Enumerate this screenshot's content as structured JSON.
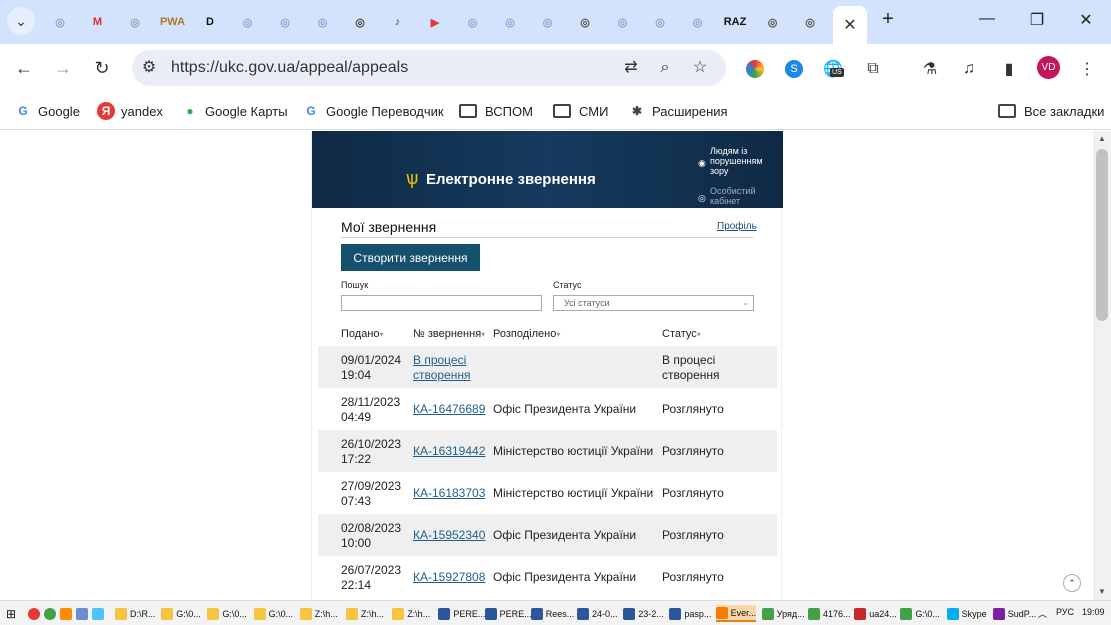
{
  "browser": {
    "tabs": [
      {
        "icon": "gear-icon",
        "label": ""
      },
      {
        "icon": "gmail-icon",
        "label": "M"
      },
      {
        "icon": "site-icon",
        "label": ""
      },
      {
        "icon": "site-icon",
        "label": "PWA"
      },
      {
        "icon": "site-icon",
        "label": "D"
      },
      {
        "icon": "site-icon",
        "label": ""
      },
      {
        "icon": "site-icon",
        "label": ""
      },
      {
        "icon": "site-icon",
        "label": ""
      },
      {
        "icon": "site-icon",
        "label": ""
      },
      {
        "icon": "speaker-icon",
        "label": ""
      },
      {
        "icon": "youtube-icon",
        "label": ""
      },
      {
        "icon": "site-icon",
        "label": ""
      },
      {
        "icon": "site-icon",
        "label": ""
      },
      {
        "icon": "site-icon",
        "label": ""
      },
      {
        "icon": "globe-icon",
        "label": ""
      },
      {
        "icon": "site-icon",
        "label": ""
      },
      {
        "icon": "site-icon",
        "label": ""
      },
      {
        "icon": "site-icon",
        "label": ""
      },
      {
        "icon": "site-icon",
        "label": "RAZ"
      },
      {
        "icon": "site-icon",
        "label": ""
      },
      {
        "icon": "globe-icon",
        "label": ""
      }
    ],
    "url": "https://ukc.gov.ua/appeal/appeals",
    "avatar": "VD",
    "ext_badge": "US"
  },
  "bookmarks": {
    "items": [
      {
        "label": "Google",
        "icon": "G"
      },
      {
        "label": "yandex",
        "icon": "Я"
      },
      {
        "label": "Google Карты",
        "icon": "♦"
      },
      {
        "label": "Google Переводчик",
        "icon": "G"
      },
      {
        "label": "ВСПОМ",
        "icon": "folder"
      },
      {
        "label": "СМИ",
        "icon": "folder"
      },
      {
        "label": "Расширения",
        "icon": "puzzle"
      }
    ],
    "all_label": "Все закладки"
  },
  "portal": {
    "banner_title": "Електронне звернення",
    "vision_link": "Людям із порушенням зору",
    "cabinet_link": "Особистий кабінет",
    "page_title": "Мої звернення",
    "profile_link": "Профіль",
    "create_button": "Створити звернення",
    "search_label": "Пошук",
    "search_value": "",
    "status_label": "Статус",
    "status_value": "Усі статуси",
    "columns": [
      "Подано",
      "№ звернення",
      "Розподілено",
      "Статус"
    ],
    "rows": [
      {
        "date": "09/01/2024",
        "time": "19:04",
        "number": "В процесі створення",
        "assigned": "",
        "status": "В процесі створення"
      },
      {
        "date": "28/11/2023",
        "time": "04:49",
        "number": "КА-16476689",
        "assigned": "Офіс Президента України",
        "status": "Розглянуто"
      },
      {
        "date": "26/10/2023",
        "time": "17:22",
        "number": "КА-16319442",
        "assigned": "Міністерство юстиції України",
        "status": "Розглянуто"
      },
      {
        "date": "27/09/2023",
        "time": "07:43",
        "number": "КА-16183703",
        "assigned": "Міністерство юстиції України",
        "status": "Розглянуто"
      },
      {
        "date": "02/08/2023",
        "time": "10:00",
        "number": "КА-15952340",
        "assigned": "Офіс Президента України",
        "status": "Розглянуто"
      },
      {
        "date": "26/07/2023",
        "time": "22:14",
        "number": "КА-15927808",
        "assigned": "Офіс Президента України",
        "status": "Розглянуто"
      }
    ]
  },
  "taskbar": {
    "items": [
      "D:\\R...",
      "G:\\0...",
      "G:\\0...",
      "G:\\0...",
      "Z:\\h...",
      "Z:\\h...",
      "Z:\\h...",
      "PERE...",
      "PERE...",
      "Rees...",
      "24-0...",
      "23-2...",
      "pasp...",
      "Ever...",
      "Уряд...",
      "4176...",
      "ua24...",
      "G:\\0...",
      "Skype",
      "SudP..."
    ],
    "active_index": 13,
    "language": "РУС",
    "time": "19:09"
  }
}
